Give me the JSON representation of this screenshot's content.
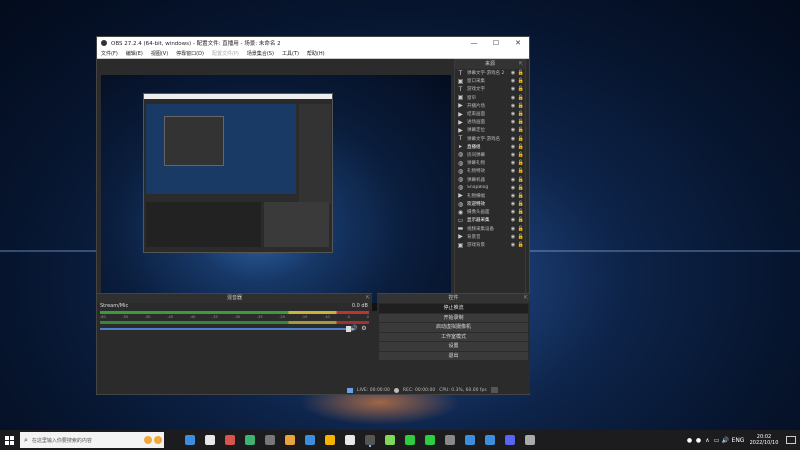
{
  "window": {
    "title": "OBS 27.2.4 (64-bit, windows) - 配置文件: 直播用 - 场景: 未命名 2",
    "minimize": "—",
    "maximize": "☐",
    "close": "✕"
  },
  "menu": [
    "文件(F)",
    "编辑(E)",
    "视图(V)",
    "停靠窗口(D)",
    "配置文件(P)",
    "场景集合(S)",
    "工具(T)",
    "帮助(H)"
  ],
  "menu_disabled_index": 4,
  "sources": {
    "header": "来源",
    "items": [
      {
        "icon": "text-icon",
        "glyph": "T",
        "name": "弹幕文字-游戏名 2"
      },
      {
        "icon": "image-icon",
        "glyph": "▣",
        "name": "窗口采集"
      },
      {
        "icon": "text-icon",
        "glyph": "T",
        "name": "游戏文字"
      },
      {
        "icon": "image-icon",
        "glyph": "▣",
        "name": "窗帘"
      },
      {
        "icon": "media-icon",
        "glyph": "▶",
        "name": "开播片场"
      },
      {
        "icon": "media-icon",
        "glyph": "▶",
        "name": "结束画面"
      },
      {
        "icon": "media-icon",
        "glyph": "▶",
        "name": "进场画面"
      },
      {
        "icon": "media-icon",
        "glyph": "▶",
        "name": "弹幕定位"
      },
      {
        "icon": "text-icon",
        "glyph": "T",
        "name": "弹幕文字-游戏名"
      },
      {
        "icon": "folder-icon",
        "glyph": "▸",
        "name": "直播组",
        "bright": true
      },
      {
        "icon": "browser-icon",
        "glyph": "◍",
        "name": "房间弹幕"
      },
      {
        "icon": "browser-icon",
        "glyph": "◍",
        "name": "弹幕礼物"
      },
      {
        "icon": "browser-icon",
        "glyph": "◍",
        "name": "礼物特效"
      },
      {
        "icon": "browser-icon",
        "glyph": "◍",
        "name": "弹幕机器"
      },
      {
        "icon": "browser-icon",
        "glyph": "◍",
        "name": "SnapBlog"
      },
      {
        "icon": "media-icon",
        "glyph": "▶",
        "name": "礼物横幅"
      },
      {
        "icon": "browser-icon",
        "glyph": "◍",
        "name": "欢迎特效",
        "bright": true
      },
      {
        "icon": "camera-icon",
        "glyph": "◉",
        "name": "摄像头画面"
      },
      {
        "icon": "monitor-icon",
        "glyph": "▭",
        "name": "显示器采集",
        "bright": true
      },
      {
        "icon": "video-icon",
        "glyph": "▬",
        "name": "视频采集设备"
      },
      {
        "icon": "media-icon",
        "glyph": "▶",
        "name": "背景音"
      },
      {
        "icon": "image-icon",
        "glyph": "▣",
        "name": "游戏背景"
      }
    ],
    "toolbar": [
      "+",
      "−",
      "⚙",
      "∧",
      "∨"
    ]
  },
  "mixer": {
    "header": "混音器",
    "channel": "Stream/Mic",
    "level": "0.0 dB",
    "ticks": [
      "-60",
      "-55",
      "-50",
      "-45",
      "-40",
      "-35",
      "-30",
      "-25",
      "-20",
      "-15",
      "-10",
      "-5",
      "0"
    ]
  },
  "controls": {
    "header": "控件",
    "buttons": [
      "停止推流",
      "开始录制",
      "启动虚拟摄像机",
      "工作室模式",
      "设置",
      "退出"
    ],
    "active_index": 0
  },
  "status": {
    "live": "LIVE: 00:00:00",
    "rec": "REC: 00:00:00",
    "cpu": "CPU: 0.3%, 60.00 fps"
  },
  "taskbar": {
    "search_placeholder": "在这里输入你要搜索的内容",
    "apps": [
      "#3c8dde",
      "#e8e8e8",
      "#d9534f",
      "#3cb371",
      "#777",
      "#e8a33c",
      "#3c8dde",
      "#f4b400",
      "#e8e8e8",
      "#555",
      "#7ed957",
      "#2ecc40",
      "#2ecc40",
      "#888",
      "#3c8dde",
      "#3c8dde",
      "#5865f2",
      "#aaa"
    ],
    "running_index": 9,
    "language": "ENG",
    "time": "20:02",
    "date": "2022/10/10"
  }
}
